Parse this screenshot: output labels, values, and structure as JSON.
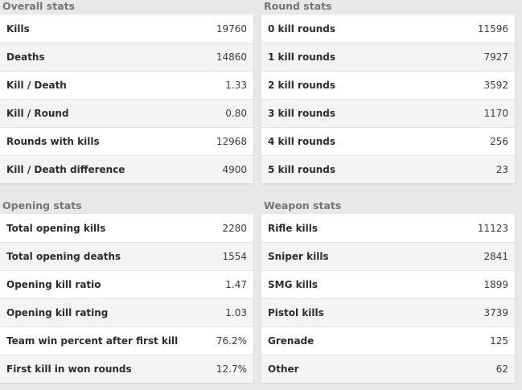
{
  "overall": {
    "title": "Overall stats",
    "rows": [
      {
        "label": "Kills",
        "value": "19760"
      },
      {
        "label": "Deaths",
        "value": "14860"
      },
      {
        "label": "Kill / Death",
        "value": "1.33"
      },
      {
        "label": "Kill / Round",
        "value": "0.80"
      },
      {
        "label": "Rounds with kills",
        "value": "12968"
      },
      {
        "label": "Kill / Death difference",
        "value": "4900"
      }
    ]
  },
  "round": {
    "title": "Round stats",
    "rows": [
      {
        "label": "0 kill rounds",
        "value": "11596"
      },
      {
        "label": "1 kill rounds",
        "value": "7927"
      },
      {
        "label": "2 kill rounds",
        "value": "3592"
      },
      {
        "label": "3 kill rounds",
        "value": "1170"
      },
      {
        "label": "4 kill rounds",
        "value": "256"
      },
      {
        "label": "5 kill rounds",
        "value": "23"
      }
    ]
  },
  "opening": {
    "title": "Opening stats",
    "rows": [
      {
        "label": "Total opening kills",
        "value": "2280"
      },
      {
        "label": "Total opening deaths",
        "value": "1554"
      },
      {
        "label": "Opening kill ratio",
        "value": "1.47"
      },
      {
        "label": "Opening kill rating",
        "value": "1.03"
      },
      {
        "label": "Team win percent after first kill",
        "value": "76.2%"
      },
      {
        "label": "First kill in won rounds",
        "value": "12.7%"
      }
    ]
  },
  "weapon": {
    "title": "Weapon stats",
    "rows": [
      {
        "label": "Rifle kills",
        "value": "11123"
      },
      {
        "label": "Sniper kills",
        "value": "2841"
      },
      {
        "label": "SMG kills",
        "value": "1899"
      },
      {
        "label": "Pistol kills",
        "value": "3739"
      },
      {
        "label": "Grenade",
        "value": "125"
      },
      {
        "label": "Other",
        "value": "62"
      }
    ]
  }
}
